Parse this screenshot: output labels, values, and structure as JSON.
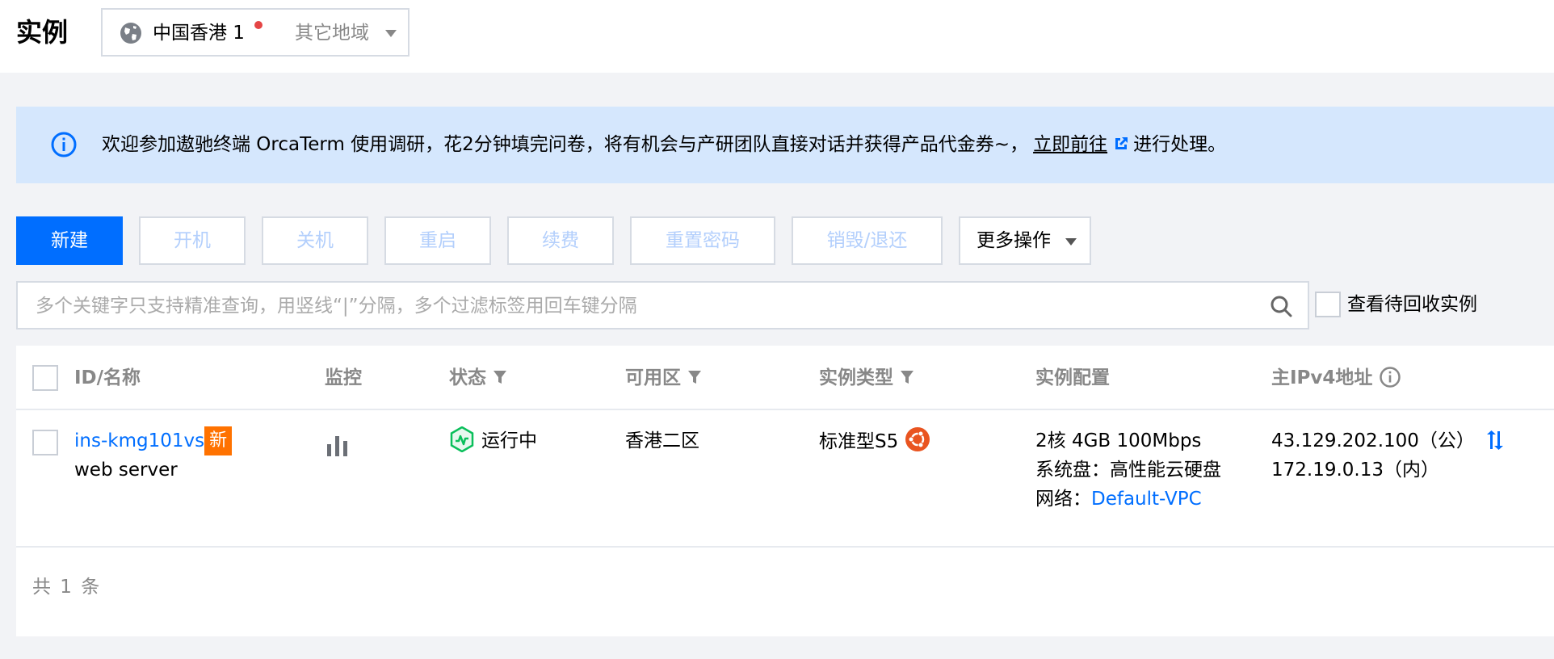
{
  "header": {
    "title": "实例",
    "region": {
      "current": "中国香港 1",
      "other": "其它地域"
    }
  },
  "notice": {
    "text": "欢迎参加遨驰终端 OrcaTerm 使用调研，花2分钟填完问卷，将有机会与产研团队直接对话并获得产品代金券~，",
    "link_label": "立即前往",
    "suffix": "进行处理。"
  },
  "toolbar": {
    "new": "新建",
    "start": "开机",
    "shutdown": "关机",
    "restart": "重启",
    "renew": "续费",
    "reset_password": "重置密码",
    "destroy": "销毁/退还",
    "more": "更多操作"
  },
  "search": {
    "placeholder": "多个关键字只支持精准查询，用竖线“|”分隔，多个过滤标签用回车键分隔",
    "recycle_label": "查看待回收实例"
  },
  "table": {
    "columns": {
      "id_name": "ID/名称",
      "monitor": "监控",
      "status": "状态",
      "zone": "可用区",
      "type": "实例类型",
      "config": "实例配置",
      "ipv4": "主IPv4地址"
    },
    "rows": [
      {
        "id": "ins-kmg101vs",
        "badge": "新",
        "name": "web server",
        "status": "运行中",
        "zone": "香港二区",
        "type": "标准型S5",
        "config_spec": "2核 4GB 100Mbps",
        "config_disk": "系统盘：高性能云硬盘",
        "config_network_label": "网络：",
        "config_network": "Default-VPC",
        "ip_public": "43.129.202.100（公）",
        "ip_private": "172.19.0.13（内）"
      }
    ],
    "footer": "共 1 条"
  },
  "colors": {
    "primary": "#006eff",
    "badge": "#ff7200",
    "running": "#0abf5b",
    "ubuntu": "#e95420",
    "notice_bg": "#d5e7fd"
  }
}
